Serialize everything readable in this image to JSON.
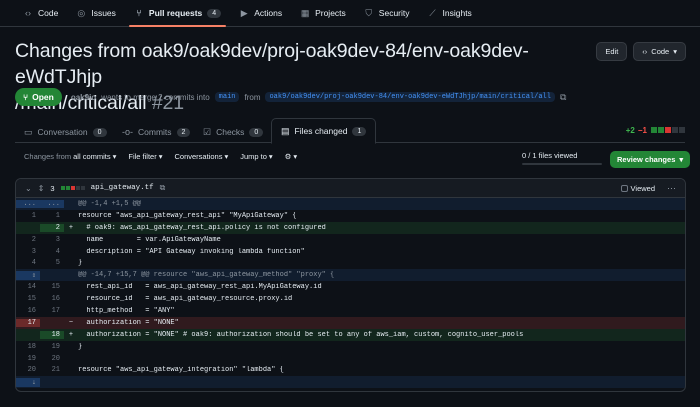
{
  "repo_nav": {
    "items": [
      {
        "label": "Code",
        "icon": "code-icon"
      },
      {
        "label": "Issues",
        "icon": "issue-icon"
      },
      {
        "label": "Pull requests",
        "icon": "pull-request-icon",
        "count": "4"
      },
      {
        "label": "Actions",
        "icon": "play-icon"
      },
      {
        "label": "Projects",
        "icon": "table-icon"
      },
      {
        "label": "Security",
        "icon": "shield-icon"
      },
      {
        "label": "Insights",
        "icon": "graph-icon"
      }
    ]
  },
  "pr": {
    "title_line1": "Changes from oak9/oak9dev/proj-oak9dev-84/env-oak9dev-eWdTJhjp",
    "title_line2": "/main/critical/all",
    "number": "#21",
    "edit_label": "Edit",
    "code_label": "Code",
    "status": "Open",
    "author": "oak9io",
    "merge_text": "wants to merge 2 commits into",
    "base_branch": "main",
    "from_text": "from",
    "head_branch": "oak9/oak9dev/proj-oak9dev-84/env-oak9dev-eWdTJhjp/main/critical/all"
  },
  "tabs": [
    {
      "label": "Conversation",
      "count": "0",
      "icon": "comment-icon"
    },
    {
      "label": "Commits",
      "count": "2",
      "icon": "commit-icon"
    },
    {
      "label": "Checks",
      "count": "0",
      "icon": "checklist-icon"
    },
    {
      "label": "Files changed",
      "count": "1",
      "icon": "file-diff-icon"
    }
  ],
  "diffstat": {
    "additions": "+2",
    "deletions": "−1"
  },
  "toolbar": {
    "changes_from_prefix": "Changes from",
    "changes_from_value": "all commits",
    "file_filter": "File filter",
    "conversations": "Conversations",
    "jump_to": "Jump to",
    "files_viewed": "0 / 1 files viewed",
    "files_viewed_fraction": 0,
    "review_button": "Review changes"
  },
  "file": {
    "changes_count": "3",
    "name": "api_gateway.tf",
    "viewed_label": "Viewed",
    "lines": [
      {
        "type": "hunk",
        "old": "...",
        "new": "...",
        "sign": "",
        "code": "@@ -1,4 +1,5 @@"
      },
      {
        "type": "context",
        "old": "1",
        "new": "1",
        "sign": "",
        "code": "resource \"aws_api_gateway_rest_api\" \"MyApiGateway\" {"
      },
      {
        "type": "added",
        "old": "",
        "new": "2",
        "sign": "+",
        "code": "  # oak9: aws_api_gateway_rest_api.policy is not configured"
      },
      {
        "type": "context",
        "old": "2",
        "new": "3",
        "sign": "",
        "code": "  name        = var.ApiGatewayName"
      },
      {
        "type": "context",
        "old": "3",
        "new": "4",
        "sign": "",
        "code": "  description = \"API Gateway invoking lambda function\""
      },
      {
        "type": "context",
        "old": "4",
        "new": "5",
        "sign": "",
        "code": "}"
      },
      {
        "type": "hunk",
        "old": "⇕",
        "new": "",
        "sign": "",
        "code": "@@ -14,7 +15,7 @@ resource \"aws_api_gateway_method\" \"proxy\" {"
      },
      {
        "type": "context",
        "old": "14",
        "new": "15",
        "sign": "",
        "code": "  rest_api_id   = aws_api_gateway_rest_api.MyApiGateway.id"
      },
      {
        "type": "context",
        "old": "15",
        "new": "16",
        "sign": "",
        "code": "  resource_id   = aws_api_gateway_resource.proxy.id"
      },
      {
        "type": "context",
        "old": "16",
        "new": "17",
        "sign": "",
        "code": "  http_method   = \"ANY\""
      },
      {
        "type": "removed",
        "old": "17",
        "new": "",
        "sign": "−",
        "code": "  authorization = \"NONE\""
      },
      {
        "type": "added",
        "old": "",
        "new": "18",
        "sign": "+",
        "code": "  authorization = \"NONE\" # oak9: authorization should be set to any of aws_iam, custom, cognito_user_pools"
      },
      {
        "type": "context",
        "old": "18",
        "new": "19",
        "sign": "",
        "code": "}"
      },
      {
        "type": "context",
        "old": "19",
        "new": "20",
        "sign": "",
        "code": ""
      },
      {
        "type": "context",
        "old": "20",
        "new": "21",
        "sign": "",
        "code": "resource \"aws_api_gateway_integration\" \"lambda\" {"
      },
      {
        "type": "hunk",
        "old": "⇣",
        "new": "",
        "sign": "",
        "code": ""
      }
    ]
  },
  "colors": {
    "accent": "#f78166",
    "open_green": "#238636",
    "link_blue": "#4493f8"
  }
}
